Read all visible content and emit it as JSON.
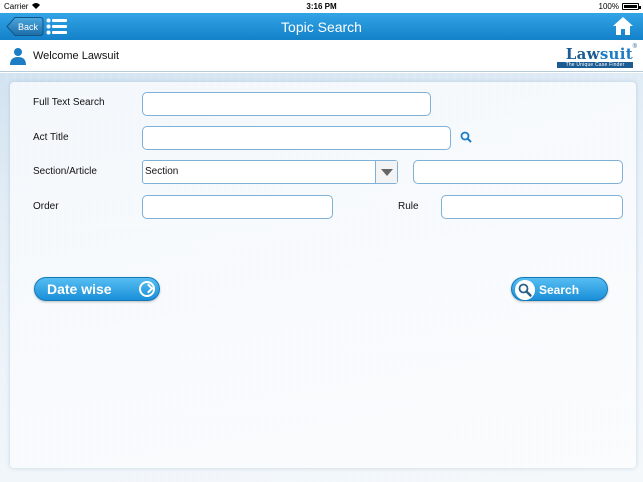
{
  "status_bar": {
    "carrier": "Carrier",
    "time": "3:16 PM",
    "battery": "100%"
  },
  "nav_bar": {
    "back_label": "Back",
    "title": "Topic Search"
  },
  "welcome_bar": {
    "welcome_text": "Welcome Lawsuit",
    "logo": {
      "name_part1": "Law",
      "name_part2": "suit",
      "registered": "®",
      "tagline": "The Unique Case Finder"
    }
  },
  "form": {
    "full_text_search": {
      "label": "Full Text Search",
      "value": ""
    },
    "act_title": {
      "label": "Act Title",
      "value": ""
    },
    "section_article": {
      "label": "Section/Article",
      "selected": "Section",
      "value": ""
    },
    "order": {
      "label": "Order",
      "value": ""
    },
    "rule": {
      "label": "Rule",
      "value": ""
    }
  },
  "buttons": {
    "date_wise": "Date wise",
    "search": "Search"
  },
  "colors": {
    "nav_blue": "#1381c9",
    "button_blue": "#1a8fd8",
    "field_border": "#7fb0d6",
    "logo_blue": "#1d5c93"
  }
}
